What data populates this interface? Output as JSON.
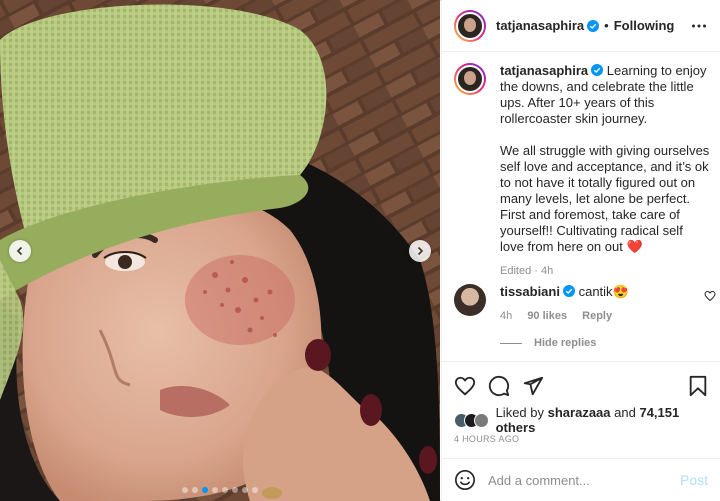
{
  "post": {
    "author": "tatjanasaphira",
    "follow_separator": "•",
    "follow_status": "Following",
    "caption_para1": "Learning to enjoy the downs, and celebrate the little ups. After 10+ years of this rollercoaster skin journey.",
    "caption_para2": "We all struggle with giving ourselves self love and acceptance, and it’s ok to not have it totally figured out on many levels, let alone be perfect. First and foremost, take care of yourself!! Cultivating radical self love from here on out",
    "caption_emoji": "❤️",
    "caption_meta": "Edited · 4h",
    "carousel": {
      "total": 8,
      "active": 2
    }
  },
  "comment": {
    "author": "tissabiani",
    "text": "cantik",
    "emoji": "😍",
    "time": "4h",
    "likes": "90 likes",
    "reply": "Reply"
  },
  "hide_replies": "Hide replies",
  "likes": {
    "prefix": "Liked by",
    "user": "sharazaaa",
    "conj": "and",
    "others": "74,151 others"
  },
  "timestamp": "4 HOURS AGO",
  "add_comment": {
    "placeholder": "Add a comment...",
    "post_label": "Post"
  },
  "colors": {
    "verified": "#0095f6",
    "heart": "#ed4956",
    "post_disabled": "#b2dffc"
  }
}
